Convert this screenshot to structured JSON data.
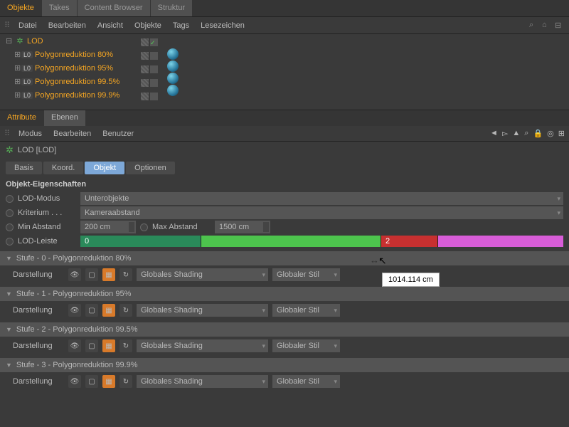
{
  "tabs": {
    "objekte": "Objekte",
    "takes": "Takes",
    "content": "Content Browser",
    "struktur": "Struktur"
  },
  "menu1": {
    "datei": "Datei",
    "bearbeiten": "Bearbeiten",
    "ansicht": "Ansicht",
    "objekte": "Objekte",
    "tags": "Tags",
    "lesezeichen": "Lesezeichen"
  },
  "tree": {
    "root": "LOD",
    "lo": "L0",
    "items": [
      "Polygonreduktion 80%",
      "Polygonreduktion 95%",
      "Polygonreduktion 99.5%",
      "Polygonreduktion 99.9%"
    ]
  },
  "attrTabs": {
    "attribute": "Attribute",
    "ebenen": "Ebenen"
  },
  "menu2": {
    "modus": "Modus",
    "bearbeiten": "Bearbeiten",
    "benutzer": "Benutzer"
  },
  "lodTitle": "LOD [LOD]",
  "subtabs": {
    "basis": "Basis",
    "koord": "Koord.",
    "objekt": "Objekt",
    "optionen": "Optionen"
  },
  "section": "Objekt-Eigenschaften",
  "props": {
    "lodmodus": {
      "label": "LOD-Modus",
      "value": "Unterobjekte"
    },
    "kriterium": {
      "label": "Kriterium",
      "dots": ". . .",
      "value": "Kameraabstand"
    },
    "minabstand": {
      "label": "Min Abstand",
      "value": "200 cm"
    },
    "maxabstand": {
      "label": "Max Abstand",
      "value": "1500 cm"
    },
    "lodleiste": {
      "label": "LOD-Leiste",
      "seg0": "0",
      "seg2": "2"
    }
  },
  "tooltip": "1014.114 cm",
  "stufen": [
    {
      "title": "Stufe - 0 - Polygonreduktion 80%"
    },
    {
      "title": "Stufe - 1 - Polygonreduktion 95%"
    },
    {
      "title": "Stufe - 2 - Polygonreduktion 99.5%"
    },
    {
      "title": "Stufe - 3 - Polygonreduktion 99.9%"
    }
  ],
  "darstellung": "Darstellung",
  "shading": "Globales Shading",
  "stil": "Globaler Stil"
}
